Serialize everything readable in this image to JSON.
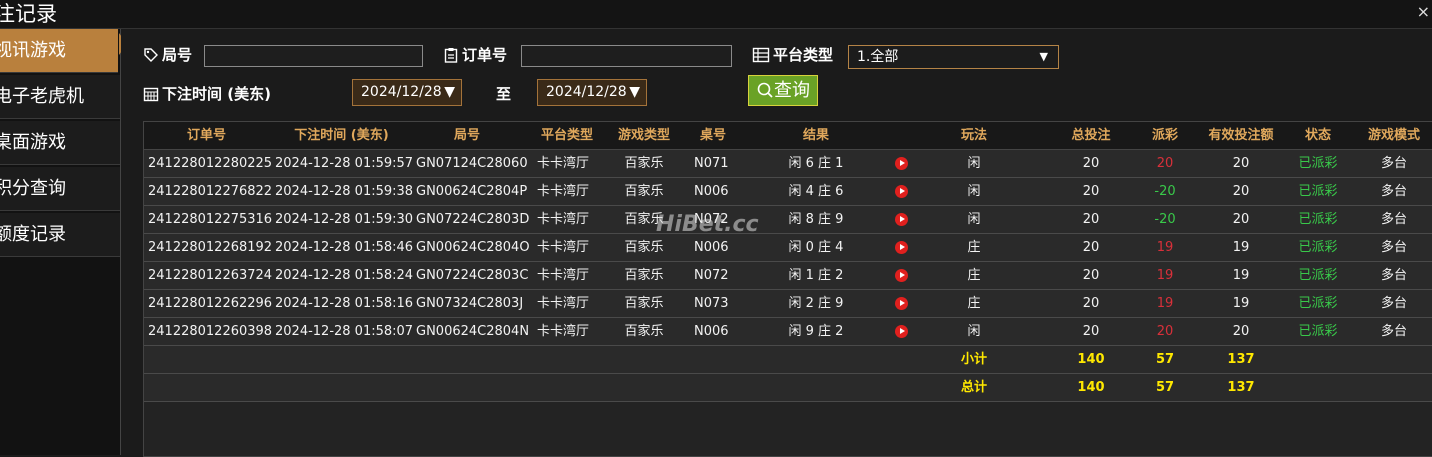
{
  "window": {
    "title": "注记录",
    "close": "×"
  },
  "sidebar": {
    "items": [
      {
        "label": "视讯游戏",
        "active": true
      },
      {
        "label": "电子老虎机",
        "active": false
      },
      {
        "label": "桌面游戏",
        "active": false
      },
      {
        "label": "积分查询",
        "active": false
      },
      {
        "label": "额度记录",
        "active": false
      }
    ]
  },
  "filters": {
    "round_label": "局号",
    "round_value": "",
    "order_label": "订单号",
    "order_value": "",
    "platform_label": "平台类型",
    "platform_selected": "1.全部",
    "time_label": "下注时间 (美东)",
    "date_from": "2024/12/28",
    "to_label": "至",
    "date_to": "2024/12/28",
    "query_button": "查询"
  },
  "table": {
    "columns": [
      "订单号",
      "下注时间 (美东)",
      "局号",
      "平台类型",
      "游戏类型",
      "桌号",
      "结果",
      "玩法",
      "总投注",
      "派彩",
      "有效投注额",
      "状态",
      "游戏模式"
    ],
    "rows": [
      [
        "241228012280225",
        "2024-12-28 01:59:57",
        "GN07124C28060",
        "卡卡湾厅",
        "百家乐",
        "N071",
        "闲 6 庄 1",
        "闲",
        "20",
        "20",
        "20",
        "已派彩",
        "多台"
      ],
      [
        "241228012276822",
        "2024-12-28 01:59:38",
        "GN00624C2804P",
        "卡卡湾厅",
        "百家乐",
        "N006",
        "闲 4 庄 6",
        "闲",
        "20",
        "-20",
        "20",
        "已派彩",
        "多台"
      ],
      [
        "241228012275316",
        "2024-12-28 01:59:30",
        "GN07224C2803D",
        "卡卡湾厅",
        "百家乐",
        "N072",
        "闲 8 庄 9",
        "闲",
        "20",
        "-20",
        "20",
        "已派彩",
        "多台"
      ],
      [
        "241228012268192",
        "2024-12-28 01:58:46",
        "GN00624C2804O",
        "卡卡湾厅",
        "百家乐",
        "N006",
        "闲 0 庄 4",
        "庄",
        "20",
        "19",
        "19",
        "已派彩",
        "多台"
      ],
      [
        "241228012263724",
        "2024-12-28 01:58:24",
        "GN07224C2803C",
        "卡卡湾厅",
        "百家乐",
        "N072",
        "闲 1 庄 2",
        "庄",
        "20",
        "19",
        "19",
        "已派彩",
        "多台"
      ],
      [
        "241228012262296",
        "2024-12-28 01:58:16",
        "GN07324C2803J",
        "卡卡湾厅",
        "百家乐",
        "N073",
        "闲 2 庄 9",
        "庄",
        "20",
        "19",
        "19",
        "已派彩",
        "多台"
      ],
      [
        "241228012260398",
        "2024-12-28 01:58:07",
        "GN00624C2804N",
        "卡卡湾厅",
        "百家乐",
        "N006",
        "闲 9 庄 2",
        "闲",
        "20",
        "20",
        "20",
        "已派彩",
        "多台"
      ]
    ],
    "subtotal": {
      "label": "小计",
      "total_bet": "140",
      "payout": "57",
      "valid_bet": "137"
    },
    "total": {
      "label": "总计",
      "total_bet": "140",
      "payout": "57",
      "valid_bet": "137"
    }
  },
  "watermark": "HiBet.cc",
  "colors": {
    "accent": "#b9803d",
    "header_text": "#e0a85c",
    "sum_text": "#ffe800",
    "loss": "#39c94a",
    "win": "#d9303a",
    "query_button": "#6aa226"
  }
}
